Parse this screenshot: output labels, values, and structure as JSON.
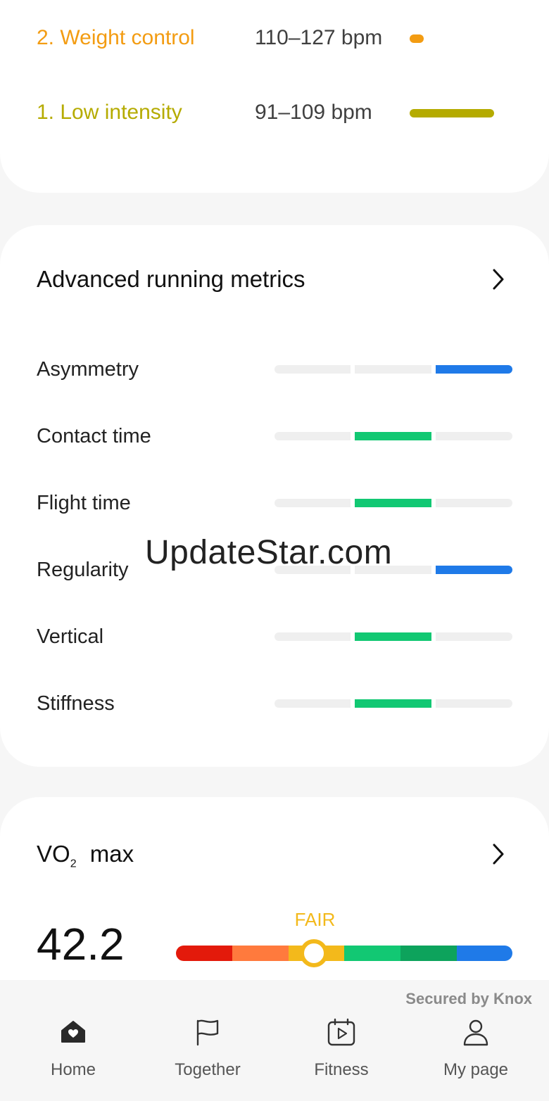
{
  "heart_rate_zones": [
    {
      "name": "2. Weight control",
      "bpm": "110–127 bpm",
      "color": "#f39c12"
    },
    {
      "name": "1. Low intensity",
      "bpm": "91–109 bpm",
      "color": "#b5ab00"
    }
  ],
  "metrics": {
    "title": "Advanced running metrics",
    "rows": [
      {
        "label": "Asymmetry",
        "level": 3,
        "color": "#1f7ae8"
      },
      {
        "label": "Contact time",
        "level": 2,
        "color": "#12c873"
      },
      {
        "label": "Flight time",
        "level": 2,
        "color": "#12c873"
      },
      {
        "label": "Regularity",
        "level": 3,
        "color": "#1f7ae8"
      },
      {
        "label": "Vertical",
        "level": 2,
        "color": "#12c873"
      },
      {
        "label": "Stiffness",
        "level": 2,
        "color": "#12c873"
      }
    ]
  },
  "vo2": {
    "title_prefix": "VO",
    "title_sub": "2",
    "title_suffix": "max",
    "value": "42.2",
    "rating": "FAIR",
    "scale_colors": [
      "#e31a0b",
      "#ff7a3d",
      "#f3b91b",
      "#12c873",
      "#0da35c",
      "#1f7ae8"
    ]
  },
  "watermark": "UpdateStar.com",
  "footer": {
    "secured": "Secured by Knox",
    "nav": [
      {
        "label": "Home",
        "icon": "home-heart-icon"
      },
      {
        "label": "Together",
        "icon": "flag-icon"
      },
      {
        "label": "Fitness",
        "icon": "fitness-calendar-icon"
      },
      {
        "label": "My page",
        "icon": "person-icon"
      }
    ]
  }
}
